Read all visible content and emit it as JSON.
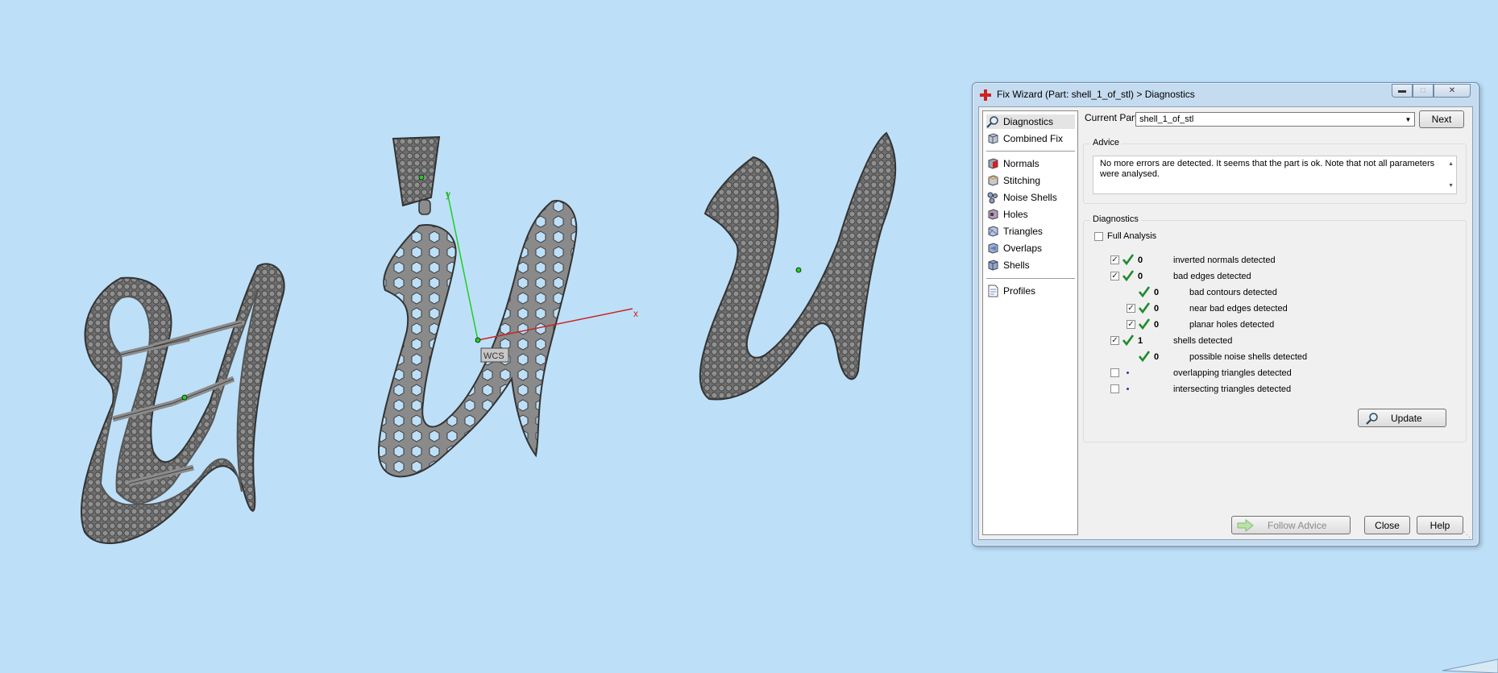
{
  "colors": {
    "background": "#bde0f8",
    "model_fill": "#8c8c8c",
    "axis_x": "#cc2222",
    "axis_y": "#22cc22"
  },
  "viewport": {
    "axis_x_label": "x",
    "axis_y_label": "y",
    "wcs_label": "WCS"
  },
  "dialog": {
    "title": "Fix Wizard (Part: shell_1_of_stl) > Diagnostics",
    "title_icon": "red-cross-icon",
    "nav": [
      {
        "label": "Diagnostics",
        "icon": "magnifier-icon"
      },
      {
        "label": "Combined Fix",
        "icon": "cube-icon"
      },
      {
        "label": "Normals",
        "icon": "normals-cube-icon"
      },
      {
        "label": "Stitching",
        "icon": "stitching-cube-icon"
      },
      {
        "label": "Noise Shells",
        "icon": "noise-shells-icon"
      },
      {
        "label": "Holes",
        "icon": "holes-cube-icon"
      },
      {
        "label": "Triangles",
        "icon": "triangles-cube-icon"
      },
      {
        "label": "Overlaps",
        "icon": "overlaps-cube-icon"
      },
      {
        "label": "Shells",
        "icon": "shells-cube-icon"
      },
      {
        "label": "Profiles",
        "icon": "profiles-doc-icon"
      }
    ],
    "current_part_label": "Current Part:",
    "current_part_value": "shell_1_of_stl",
    "next_label": "Next",
    "advice_label": "Advice",
    "advice_text": "No more errors are detected. It seems that the part is ok. Note that not all parameters were analysed.",
    "diagnostics_label": "Diagnostics",
    "full_analysis_label": "Full Analysis",
    "rows": [
      {
        "checked": true,
        "count": "0",
        "label": "inverted normals detected"
      },
      {
        "checked": true,
        "count": "0",
        "label": "bad edges detected"
      },
      {
        "checked": null,
        "count": "0",
        "label": "bad contours detected"
      },
      {
        "checked": true,
        "count": "0",
        "label": "near bad edges detected"
      },
      {
        "checked": true,
        "count": "0",
        "label": "planar holes detected"
      },
      {
        "checked": true,
        "count": "1",
        "label": "shells detected"
      },
      {
        "checked": null,
        "count": "0",
        "label": "possible noise shells detected"
      },
      {
        "checked": false,
        "count": "",
        "label": "overlapping triangles detected"
      },
      {
        "checked": false,
        "count": "",
        "label": "intersecting triangles detected"
      }
    ],
    "update_label": "Update",
    "follow_advice_label": "Follow Advice",
    "close_label": "Close",
    "help_label": "Help"
  }
}
